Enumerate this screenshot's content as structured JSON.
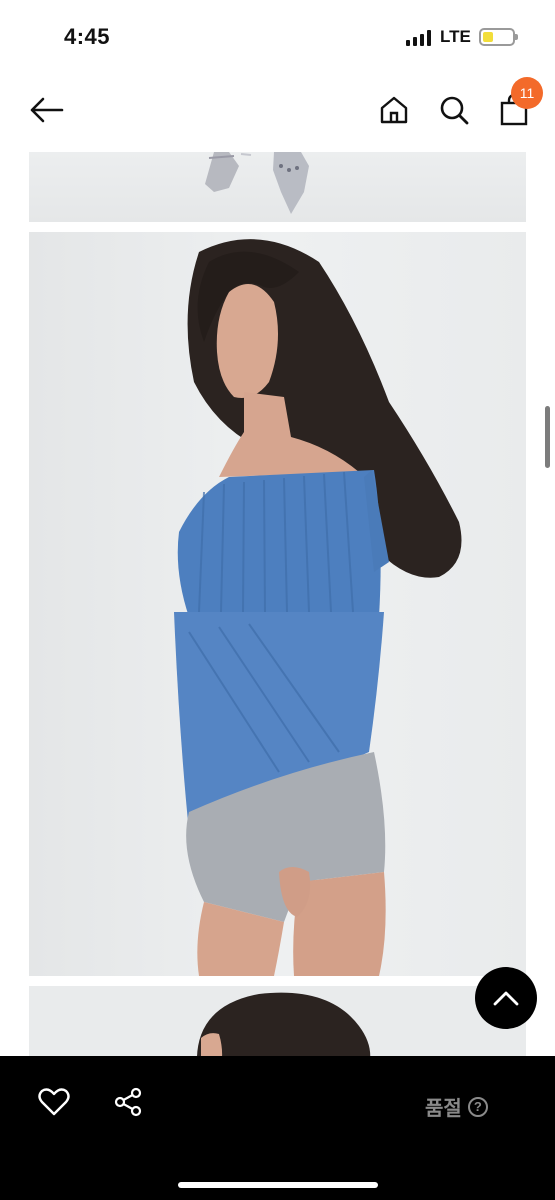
{
  "status_bar": {
    "time": "4:45",
    "network": "LTE",
    "battery_level": 0.35
  },
  "header": {
    "back_icon": "arrow-left-icon",
    "home_icon": "home-icon",
    "search_icon": "search-icon",
    "bag_icon": "shopping-bag-icon",
    "cart_count": "11",
    "badge_color": "#f36a2a"
  },
  "product_images": [
    {
      "subject": "silver pointed heels"
    },
    {
      "subject": "model in blue ribbed off-shoulder knit top and grey shorts"
    },
    {
      "subject": "model with curly dark hair"
    }
  ],
  "scroll_top": {
    "icon": "chevron-up-icon"
  },
  "bottom_bar": {
    "like_icon": "heart-icon",
    "share_icon": "share-icon",
    "status_label": "품절",
    "help_icon": "question-circle-icon",
    "help_glyph": "?"
  }
}
